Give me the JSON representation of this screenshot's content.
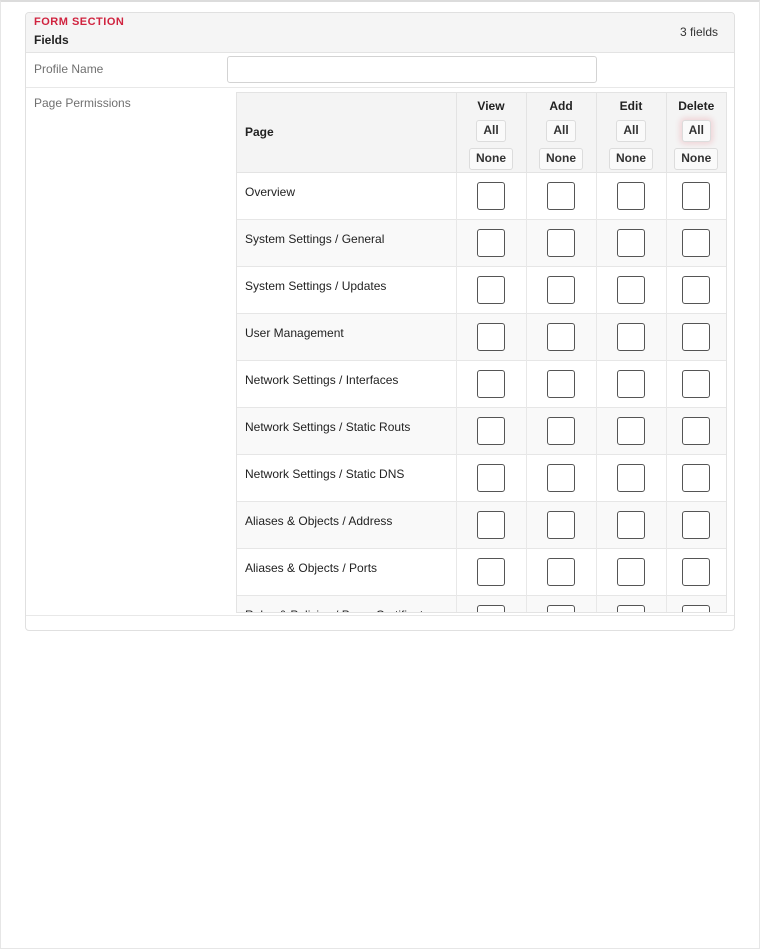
{
  "section": {
    "label": "FORM SECTION",
    "title": "Fields",
    "field_count": "3 fields"
  },
  "profile": {
    "label": "Profile Name",
    "value": ""
  },
  "permissions": {
    "label": "Page Permissions",
    "page_header": "Page",
    "columns": [
      {
        "title": "View",
        "all": "All",
        "none": "None"
      },
      {
        "title": "Add",
        "all": "All",
        "none": "None"
      },
      {
        "title": "Edit",
        "all": "All",
        "none": "None"
      },
      {
        "title": "Delete",
        "all": "All",
        "none": "None"
      }
    ],
    "rows": [
      {
        "page": "Overview",
        "checks": [
          false,
          false,
          false,
          false
        ]
      },
      {
        "page": "System Settings / General",
        "checks": [
          false,
          false,
          false,
          false
        ]
      },
      {
        "page": "System Settings / Updates",
        "checks": [
          false,
          false,
          false,
          false
        ]
      },
      {
        "page": "User Management",
        "checks": [
          false,
          false,
          false,
          false
        ]
      },
      {
        "page": "Network Settings / Interfaces",
        "checks": [
          false,
          false,
          false,
          false
        ]
      },
      {
        "page": "Network Settings / Static Routs",
        "checks": [
          false,
          false,
          false,
          false
        ]
      },
      {
        "page": "Network Settings / Static DNS",
        "checks": [
          false,
          false,
          false,
          false
        ]
      },
      {
        "page": "Aliases & Objects / Address",
        "checks": [
          false,
          false,
          false,
          false
        ]
      },
      {
        "page": "Aliases & Objects / Ports",
        "checks": [
          false,
          false,
          false,
          false
        ]
      },
      {
        "page": "Rules & Policies / Proxy Certificates",
        "checks": [
          false,
          false,
          false,
          false
        ]
      }
    ]
  },
  "colors": {
    "accent": "#d0233f",
    "header_bg": "#f5f5f5",
    "border": "#e0e0e0"
  }
}
